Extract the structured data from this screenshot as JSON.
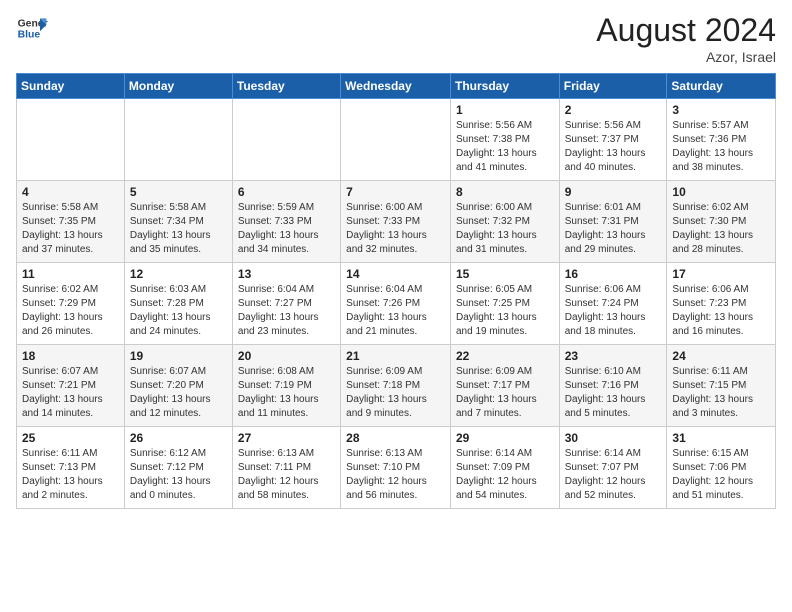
{
  "logo": {
    "text_general": "General",
    "text_blue": "Blue"
  },
  "title": {
    "month_year": "August 2024",
    "location": "Azor, Israel"
  },
  "days_of_week": [
    "Sunday",
    "Monday",
    "Tuesday",
    "Wednesday",
    "Thursday",
    "Friday",
    "Saturday"
  ],
  "weeks": [
    [
      {
        "day": "",
        "info": ""
      },
      {
        "day": "",
        "info": ""
      },
      {
        "day": "",
        "info": ""
      },
      {
        "day": "",
        "info": ""
      },
      {
        "day": "1",
        "info": "Sunrise: 5:56 AM\nSunset: 7:38 PM\nDaylight: 13 hours\nand 41 minutes."
      },
      {
        "day": "2",
        "info": "Sunrise: 5:56 AM\nSunset: 7:37 PM\nDaylight: 13 hours\nand 40 minutes."
      },
      {
        "day": "3",
        "info": "Sunrise: 5:57 AM\nSunset: 7:36 PM\nDaylight: 13 hours\nand 38 minutes."
      }
    ],
    [
      {
        "day": "4",
        "info": "Sunrise: 5:58 AM\nSunset: 7:35 PM\nDaylight: 13 hours\nand 37 minutes."
      },
      {
        "day": "5",
        "info": "Sunrise: 5:58 AM\nSunset: 7:34 PM\nDaylight: 13 hours\nand 35 minutes."
      },
      {
        "day": "6",
        "info": "Sunrise: 5:59 AM\nSunset: 7:33 PM\nDaylight: 13 hours\nand 34 minutes."
      },
      {
        "day": "7",
        "info": "Sunrise: 6:00 AM\nSunset: 7:33 PM\nDaylight: 13 hours\nand 32 minutes."
      },
      {
        "day": "8",
        "info": "Sunrise: 6:00 AM\nSunset: 7:32 PM\nDaylight: 13 hours\nand 31 minutes."
      },
      {
        "day": "9",
        "info": "Sunrise: 6:01 AM\nSunset: 7:31 PM\nDaylight: 13 hours\nand 29 minutes."
      },
      {
        "day": "10",
        "info": "Sunrise: 6:02 AM\nSunset: 7:30 PM\nDaylight: 13 hours\nand 28 minutes."
      }
    ],
    [
      {
        "day": "11",
        "info": "Sunrise: 6:02 AM\nSunset: 7:29 PM\nDaylight: 13 hours\nand 26 minutes."
      },
      {
        "day": "12",
        "info": "Sunrise: 6:03 AM\nSunset: 7:28 PM\nDaylight: 13 hours\nand 24 minutes."
      },
      {
        "day": "13",
        "info": "Sunrise: 6:04 AM\nSunset: 7:27 PM\nDaylight: 13 hours\nand 23 minutes."
      },
      {
        "day": "14",
        "info": "Sunrise: 6:04 AM\nSunset: 7:26 PM\nDaylight: 13 hours\nand 21 minutes."
      },
      {
        "day": "15",
        "info": "Sunrise: 6:05 AM\nSunset: 7:25 PM\nDaylight: 13 hours\nand 19 minutes."
      },
      {
        "day": "16",
        "info": "Sunrise: 6:06 AM\nSunset: 7:24 PM\nDaylight: 13 hours\nand 18 minutes."
      },
      {
        "day": "17",
        "info": "Sunrise: 6:06 AM\nSunset: 7:23 PM\nDaylight: 13 hours\nand 16 minutes."
      }
    ],
    [
      {
        "day": "18",
        "info": "Sunrise: 6:07 AM\nSunset: 7:21 PM\nDaylight: 13 hours\nand 14 minutes."
      },
      {
        "day": "19",
        "info": "Sunrise: 6:07 AM\nSunset: 7:20 PM\nDaylight: 13 hours\nand 12 minutes."
      },
      {
        "day": "20",
        "info": "Sunrise: 6:08 AM\nSunset: 7:19 PM\nDaylight: 13 hours\nand 11 minutes."
      },
      {
        "day": "21",
        "info": "Sunrise: 6:09 AM\nSunset: 7:18 PM\nDaylight: 13 hours\nand 9 minutes."
      },
      {
        "day": "22",
        "info": "Sunrise: 6:09 AM\nSunset: 7:17 PM\nDaylight: 13 hours\nand 7 minutes."
      },
      {
        "day": "23",
        "info": "Sunrise: 6:10 AM\nSunset: 7:16 PM\nDaylight: 13 hours\nand 5 minutes."
      },
      {
        "day": "24",
        "info": "Sunrise: 6:11 AM\nSunset: 7:15 PM\nDaylight: 13 hours\nand 3 minutes."
      }
    ],
    [
      {
        "day": "25",
        "info": "Sunrise: 6:11 AM\nSunset: 7:13 PM\nDaylight: 13 hours\nand 2 minutes."
      },
      {
        "day": "26",
        "info": "Sunrise: 6:12 AM\nSunset: 7:12 PM\nDaylight: 13 hours\nand 0 minutes."
      },
      {
        "day": "27",
        "info": "Sunrise: 6:13 AM\nSunset: 7:11 PM\nDaylight: 12 hours\nand 58 minutes."
      },
      {
        "day": "28",
        "info": "Sunrise: 6:13 AM\nSunset: 7:10 PM\nDaylight: 12 hours\nand 56 minutes."
      },
      {
        "day": "29",
        "info": "Sunrise: 6:14 AM\nSunset: 7:09 PM\nDaylight: 12 hours\nand 54 minutes."
      },
      {
        "day": "30",
        "info": "Sunrise: 6:14 AM\nSunset: 7:07 PM\nDaylight: 12 hours\nand 52 minutes."
      },
      {
        "day": "31",
        "info": "Sunrise: 6:15 AM\nSunset: 7:06 PM\nDaylight: 12 hours\nand 51 minutes."
      }
    ]
  ]
}
